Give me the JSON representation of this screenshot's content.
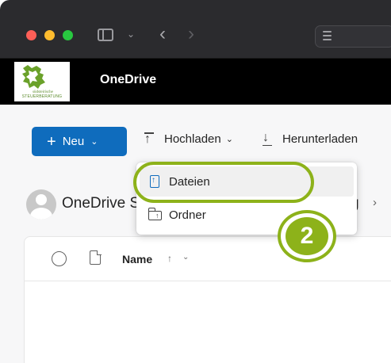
{
  "browser": {
    "traffic_lights": [
      "#fe5f57",
      "#febc2e",
      "#28c840"
    ],
    "icons": [
      "sidebar-toggle-icon",
      "chevron-down-icon",
      "back-arrow-icon",
      "forward-arrow-icon",
      "tab-overview-icon"
    ]
  },
  "header": {
    "logo_text": "südsteirische",
    "logo_subtext": "STEUERBERATUNG",
    "app_title": "OneDrive"
  },
  "toolbar": {
    "new_label": "Neu",
    "upload_label": "Hochladen",
    "download_label": "Herunterladen"
  },
  "upload_menu": {
    "items": [
      {
        "label": "Dateien",
        "icon": "file-upload-icon",
        "highlighted": true
      },
      {
        "label": "Ordner",
        "icon": "folder-upload-icon",
        "highlighted": false
      }
    ]
  },
  "breadcrumb": {
    "root": "OneDrive S",
    "tail": "g"
  },
  "file_list": {
    "columns": [
      {
        "label": "Name",
        "sort": "ascending"
      }
    ]
  },
  "annotation": {
    "step_number": "2",
    "color": "#8db21a"
  },
  "colors": {
    "primary": "#0f6cbd",
    "app_header": "#000000"
  }
}
